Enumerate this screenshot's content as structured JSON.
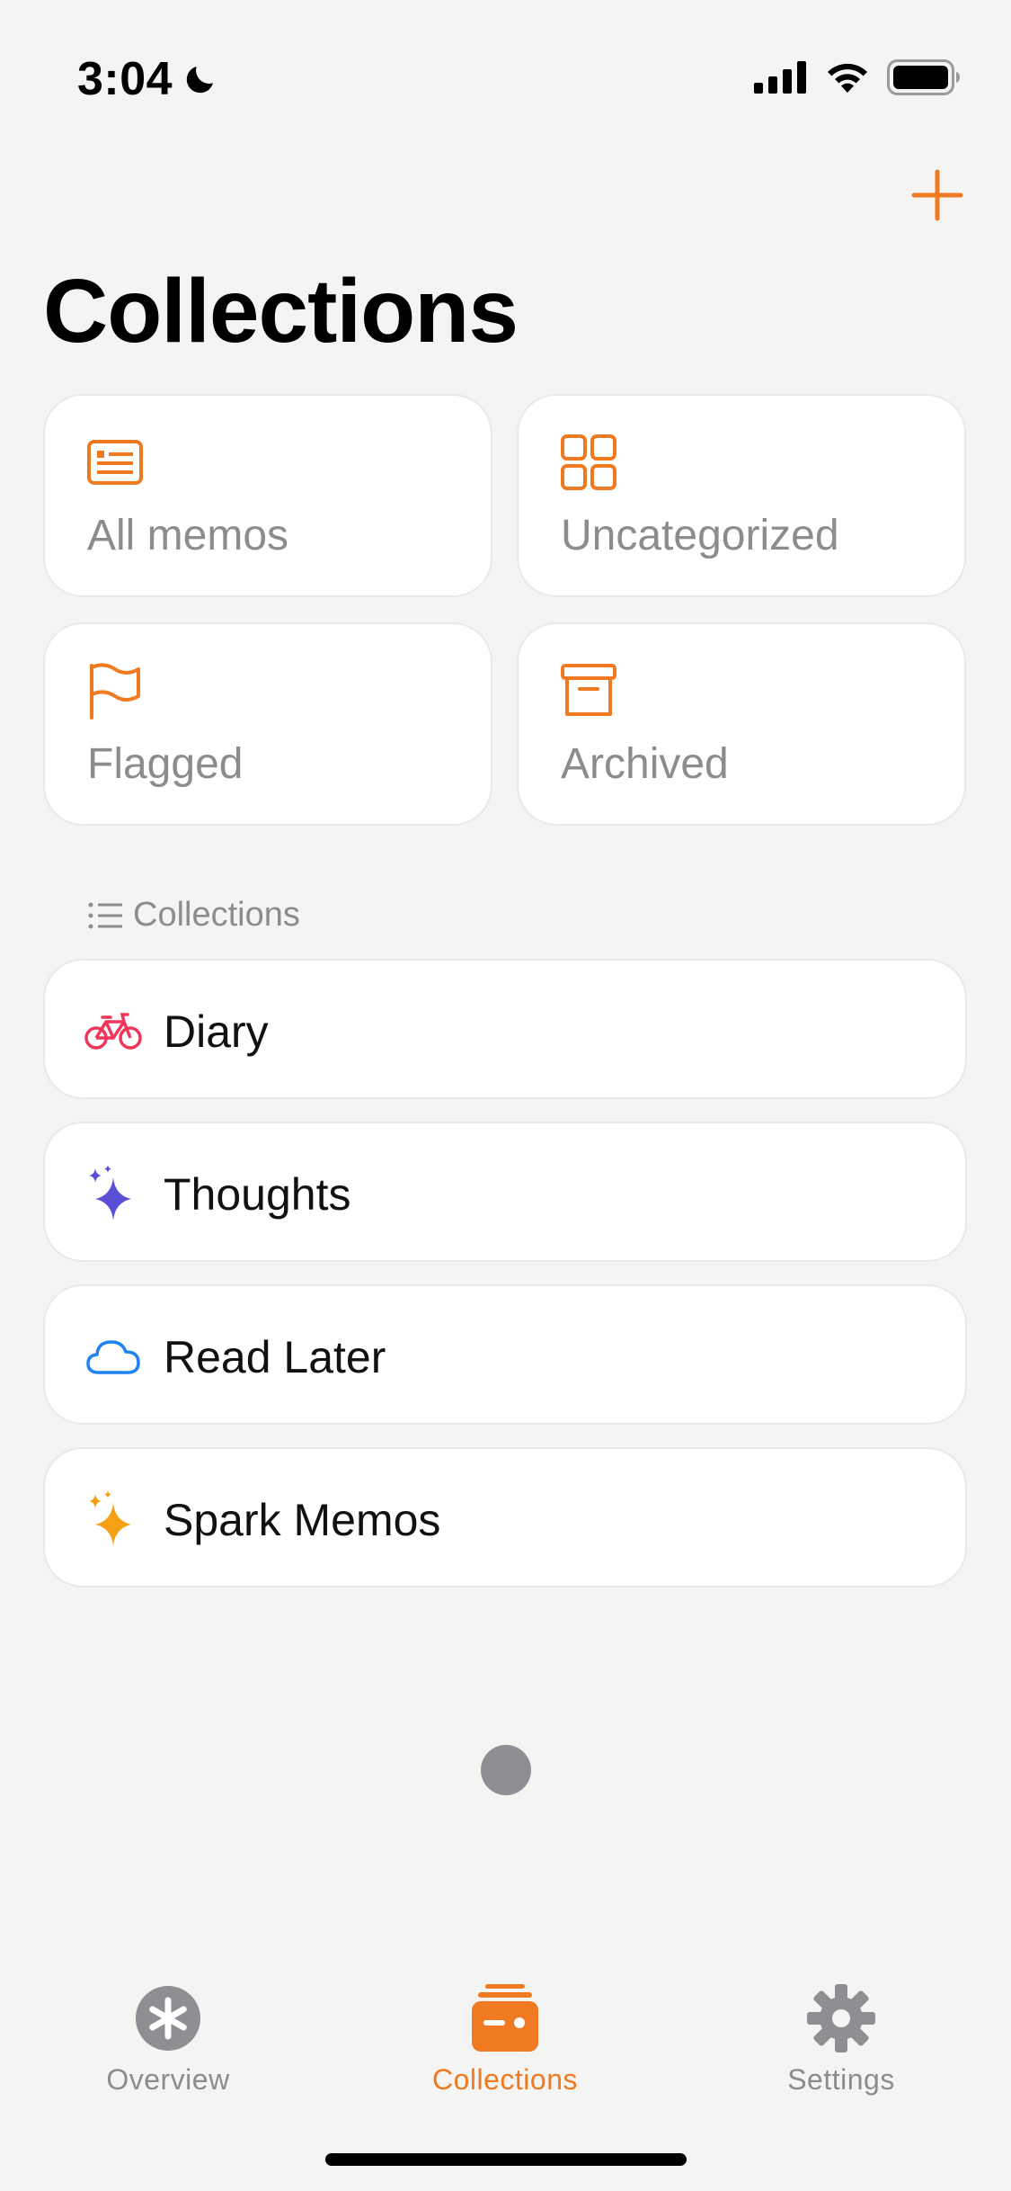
{
  "status_bar": {
    "time": "3:04",
    "icons": [
      "moon-icon",
      "cellular-signal-icon",
      "wifi-icon",
      "battery-icon"
    ]
  },
  "header": {
    "title": "Collections",
    "add_icon": "plus-icon"
  },
  "colors": {
    "accent": "#f07a22",
    "diary": "#f0365a",
    "thoughts": "#5b4fd6",
    "read_later": "#1e82f0",
    "spark": "#f5a015",
    "secondary_text": "#8c8c8e"
  },
  "smart_collections": [
    {
      "label": "All memos",
      "icon": "memo-list-icon"
    },
    {
      "label": "Uncategorized",
      "icon": "grid-icon"
    },
    {
      "label": "Flagged",
      "icon": "flag-icon"
    },
    {
      "label": "Archived",
      "icon": "archive-box-icon"
    }
  ],
  "section": {
    "label": "Collections",
    "icon": "list-icon"
  },
  "collections": [
    {
      "label": "Diary",
      "icon": "bicycle-icon"
    },
    {
      "label": "Thoughts",
      "icon": "sparkles-icon"
    },
    {
      "label": "Read Later",
      "icon": "cloud-icon"
    },
    {
      "label": "Spark Memos",
      "icon": "sparkles-icon"
    }
  ],
  "tab_bar": {
    "tabs": [
      {
        "label": "Overview",
        "icon": "asterisk-icon",
        "selected": false
      },
      {
        "label": "Collections",
        "icon": "collections-icon",
        "selected": true
      },
      {
        "label": "Settings",
        "icon": "gear-icon",
        "selected": false
      }
    ]
  }
}
